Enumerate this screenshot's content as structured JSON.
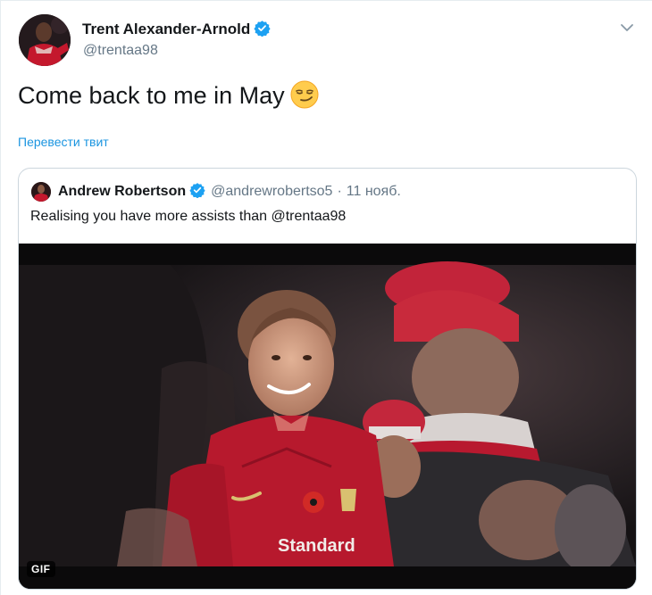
{
  "tweet": {
    "author_name": "Trent Alexander-Arnold",
    "author_handle": "@trentaa98",
    "text": "Come back to me in May",
    "emoji": "smirking-face",
    "translate_label": "Перевести твит"
  },
  "quote": {
    "author_name": "Andrew Robertson",
    "author_handle": "@andrewrobertso5",
    "separator": "·",
    "date": "11 нояб.",
    "text": "Realising you have more assists than @trentaa98",
    "media_badge": "GIF",
    "shirt_text": "Standard"
  },
  "colors": {
    "link": "#1b95e0",
    "verified": "#1da1f2",
    "secondary_text": "#657786",
    "border": "#ccd6dd",
    "liverpool_red": "#b0172a"
  }
}
